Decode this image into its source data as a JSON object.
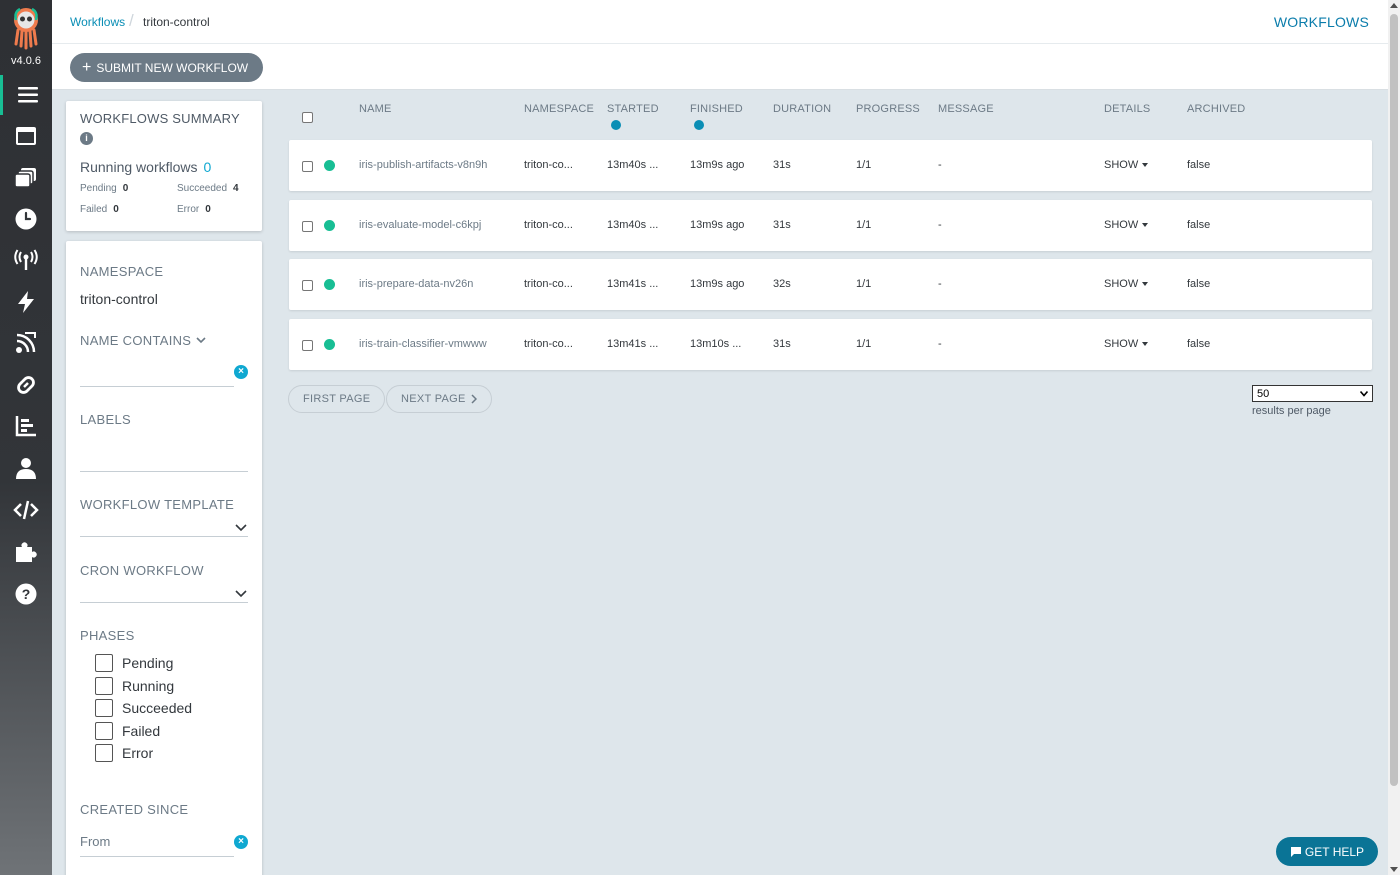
{
  "app": {
    "version": "v4.0.6"
  },
  "nav": {
    "items": [
      {
        "icon": "workflows-icon",
        "active": true
      },
      {
        "icon": "workflow-templates-icon"
      },
      {
        "icon": "cluster-templates-icon"
      },
      {
        "icon": "cron-workflows-icon"
      },
      {
        "icon": "event-sources-icon"
      },
      {
        "icon": "sensors-icon"
      },
      {
        "icon": "event-flow-icon"
      },
      {
        "icon": "archived-workflows-icon"
      },
      {
        "icon": "reports-icon"
      },
      {
        "icon": "user-icon"
      },
      {
        "icon": "api-docs-icon"
      },
      {
        "icon": "plugins-icon"
      },
      {
        "icon": "help-icon"
      }
    ]
  },
  "breadcrumb": {
    "link": "Workflows",
    "separator": "/",
    "current": "triton-control"
  },
  "header": {
    "title": "WORKFLOWS"
  },
  "toolbar": {
    "submit_plus": "+",
    "submit_label": "SUBMIT NEW WORKFLOW"
  },
  "summary": {
    "title": "WORKFLOWS SUMMARY",
    "info": "i",
    "running_label": "Running workflows",
    "running_count": "0",
    "pending_label": "Pending",
    "pending": "0",
    "succeeded_label": "Succeeded",
    "succeeded": "4",
    "failed_label": "Failed",
    "failed": "0",
    "error_label": "Error",
    "error": "0"
  },
  "filters": {
    "namespace_label": "NAMESPACE",
    "namespace_value": "triton-control",
    "name_contains_label": "NAME CONTAINS",
    "labels_label": "LABELS",
    "workflow_template_label": "WORKFLOW TEMPLATE",
    "cron_workflow_label": "CRON WORKFLOW",
    "phases_label": "PHASES",
    "phases": [
      "Pending",
      "Running",
      "Succeeded",
      "Failed",
      "Error"
    ],
    "created_since_label": "CREATED SINCE",
    "from_placeholder": "From",
    "clear_symbol": "×"
  },
  "table": {
    "columns": {
      "name": "NAME",
      "namespace": "NAMESPACE",
      "started": "STARTED",
      "finished": "FINISHED",
      "duration": "DURATION",
      "progress": "PROGRESS",
      "message": "MESSAGE",
      "details": "DETAILS",
      "archived": "ARCHIVED"
    },
    "rows": [
      {
        "name": "iris-publish-artifacts-v8n9h",
        "namespace": "triton-co...",
        "started": "13m40s ...",
        "finished": "13m9s ago",
        "duration": "31s",
        "progress": "1/1",
        "message": "-",
        "details": "SHOW",
        "archived": "false"
      },
      {
        "name": "iris-evaluate-model-c6kpj",
        "namespace": "triton-co...",
        "started": "13m40s ...",
        "finished": "13m9s ago",
        "duration": "31s",
        "progress": "1/1",
        "message": "-",
        "details": "SHOW",
        "archived": "false"
      },
      {
        "name": "iris-prepare-data-nv26n",
        "namespace": "triton-co...",
        "started": "13m41s ...",
        "finished": "13m9s ago",
        "duration": "32s",
        "progress": "1/1",
        "message": "-",
        "details": "SHOW",
        "archived": "false"
      },
      {
        "name": "iris-train-classifier-vmwww",
        "namespace": "triton-co...",
        "started": "13m41s ...",
        "finished": "13m10s ...",
        "duration": "31s",
        "progress": "1/1",
        "message": "-",
        "details": "SHOW",
        "archived": "false"
      }
    ]
  },
  "pagination": {
    "first_label": "FIRST PAGE",
    "next_label": "NEXT PAGE",
    "per_page_value": "50",
    "per_page_label": "results per page"
  },
  "help": {
    "label": "GET HELP"
  },
  "colors": {
    "accent": "#0fa8d1",
    "success": "#18be94",
    "nav_bg": "#323539",
    "help_bg": "#0a7496"
  }
}
